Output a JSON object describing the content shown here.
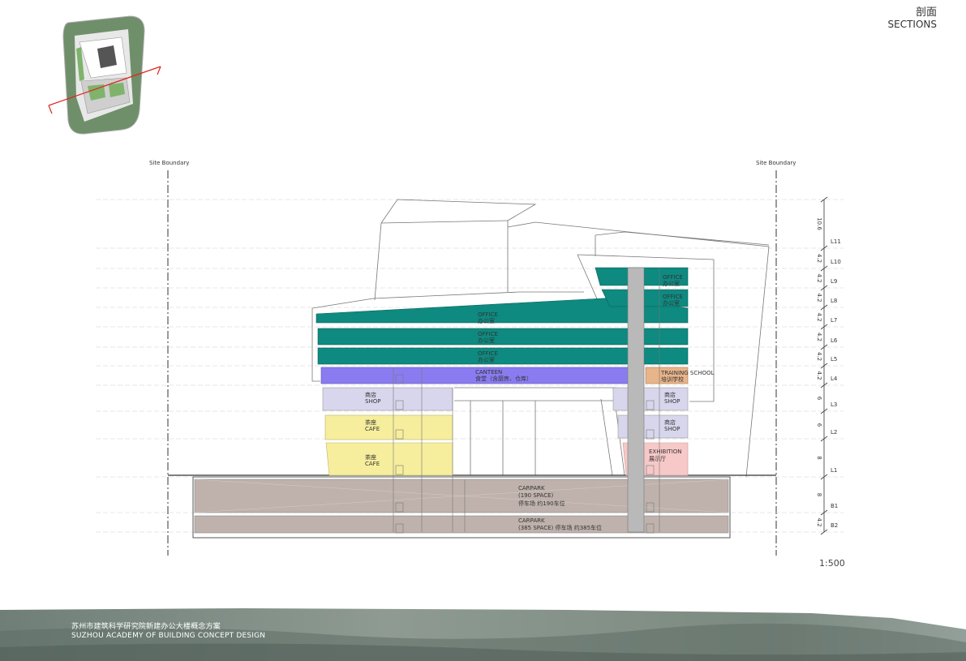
{
  "header": {
    "title_zh": "剖面",
    "title_en": "SECTIONS"
  },
  "boundary": {
    "left_label": "Site Boundary",
    "right_label": "Site Boundary"
  },
  "scale_label": "1:500",
  "levels": [
    {
      "dim": "10.6",
      "name": "L11"
    },
    {
      "dim": "4.2",
      "name": "L10"
    },
    {
      "dim": "4.2",
      "name": "L9"
    },
    {
      "dim": "4.2",
      "name": "L8"
    },
    {
      "dim": "4.2",
      "name": "L7"
    },
    {
      "dim": "4.2",
      "name": "L6"
    },
    {
      "dim": "4.2",
      "name": "L5"
    },
    {
      "dim": "4.2",
      "name": "L4"
    },
    {
      "dim": "6",
      "name": "L3"
    },
    {
      "dim": "6",
      "name": "L2"
    },
    {
      "dim": "8",
      "name": "L1"
    },
    {
      "dim": "8",
      "name": "B1"
    },
    {
      "dim": "4.2",
      "name": "B2"
    }
  ],
  "rooms": {
    "office_l7": {
      "en": "OFFICE",
      "zh": "办公室"
    },
    "office_l6": {
      "en": "OFFICE",
      "zh": "办公室"
    },
    "office_l5": {
      "en": "OFFICE",
      "zh": "办公室"
    },
    "office_l9": {
      "en": "OFFICE",
      "zh": "办公室"
    },
    "office_l8": {
      "en": "OFFICE",
      "zh": "办公室"
    },
    "canteen": {
      "en": "CANTEEN",
      "zh": "食堂（含厨房、仓库）"
    },
    "training": {
      "en": "TRAINING SCHOOL",
      "zh": "培训学校"
    },
    "shop_left": {
      "zh": "商店",
      "en": "SHOP"
    },
    "shop_r3": {
      "zh": "商店",
      "en": "SHOP"
    },
    "shop_r2": {
      "zh": "商店",
      "en": "SHOP"
    },
    "cafe_l2": {
      "zh": "茶座",
      "en": "CAFE"
    },
    "cafe_l1": {
      "zh": "茶座",
      "en": "CAFE"
    },
    "exhibition": {
      "en": "EXHIBITION",
      "zh": "展示厅"
    },
    "carpark_b1": {
      "line1": "CARPARK",
      "line2": "(190 SPACE)",
      "line3": "停车场 约190车位"
    },
    "carpark_b2": {
      "line1": "CARPARK",
      "line2": "(385 SPACE)  停车场 约385车位"
    }
  },
  "footer": {
    "title_zh": "苏州市建筑科学研究院新建办公大楼概念方案",
    "title_en": "SUZHOU ACADEMY OF BUILDING CONCEPT DESIGN"
  },
  "colors": {
    "office": "#0e8a80",
    "canteen": "#8a7cf0",
    "shop": "#d8d6ec",
    "cafe": "#f6ee9c",
    "exhibition": "#f7c8c8",
    "training": "#e8b48a",
    "carpark": "#bfb2ac",
    "core": "#b9b9b9"
  }
}
